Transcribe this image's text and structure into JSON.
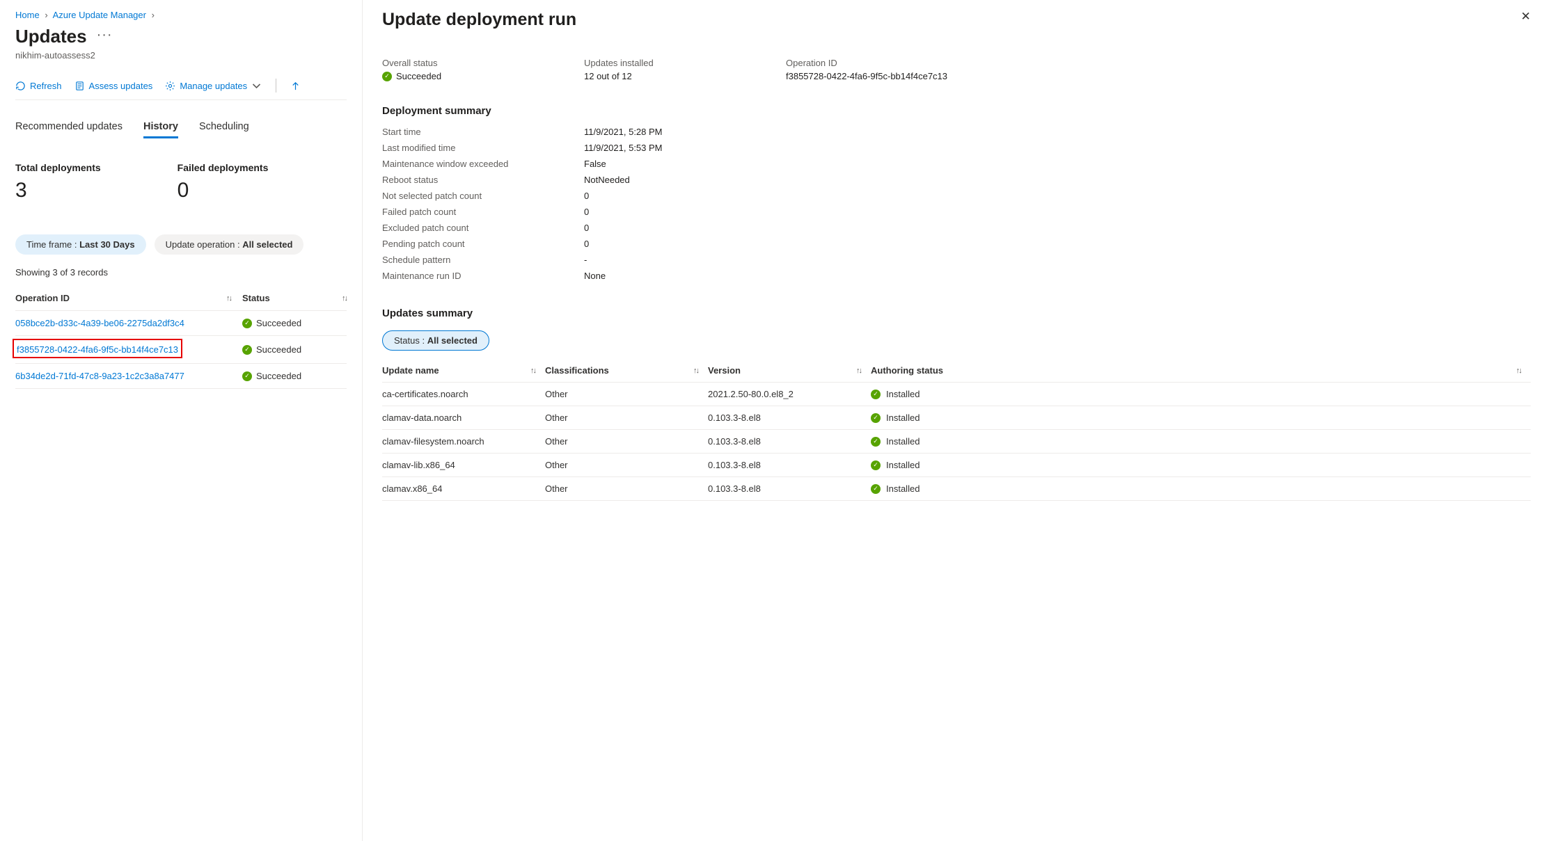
{
  "breadcrumb": {
    "home": "Home",
    "aum": "Azure Update Manager"
  },
  "page": {
    "title": "Updates",
    "subtitle": "nikhim-autoassess2"
  },
  "toolbar": {
    "refresh": "Refresh",
    "assess": "Assess updates",
    "manage": "Manage updates"
  },
  "tabs": {
    "recommended": "Recommended updates",
    "history": "History",
    "scheduling": "Scheduling"
  },
  "stats": {
    "total_label": "Total deployments",
    "total_value": "3",
    "failed_label": "Failed deployments",
    "failed_value": "0"
  },
  "filters": {
    "timeframe_label": "Time frame :",
    "timeframe_value": "Last 30 Days",
    "operation_label": "Update operation :",
    "operation_value": "All selected"
  },
  "records_count": "Showing 3 of 3 records",
  "grid_head": {
    "op": "Operation ID",
    "status": "Status"
  },
  "rows": [
    {
      "id": "058bce2b-d33c-4a39-be06-2275da2df3c4",
      "status": "Succeeded"
    },
    {
      "id": "f3855728-0422-4fa6-9f5c-bb14f4ce7c13",
      "status": "Succeeded"
    },
    {
      "id": "6b34de2d-71fd-47c8-9a23-1c2c3a8a7477",
      "status": "Succeeded"
    }
  ],
  "panel": {
    "title": "Update deployment run",
    "overall_status_label": "Overall status",
    "overall_status_value": "Succeeded",
    "updates_installed_label": "Updates installed",
    "updates_installed_value": "12 out of 12",
    "operation_id_label": "Operation ID",
    "operation_id_value": "f3855728-0422-4fa6-9f5c-bb14f4ce7c13",
    "summary_title": "Deployment summary",
    "kv": [
      {
        "k": "Start time",
        "v": "11/9/2021, 5:28 PM"
      },
      {
        "k": "Last modified time",
        "v": "11/9/2021, 5:53 PM"
      },
      {
        "k": "Maintenance window exceeded",
        "v": "False"
      },
      {
        "k": "Reboot status",
        "v": "NotNeeded"
      },
      {
        "k": "Not selected patch count",
        "v": "0"
      },
      {
        "k": "Failed patch count",
        "v": "0"
      },
      {
        "k": "Excluded patch count",
        "v": "0"
      },
      {
        "k": "Pending patch count",
        "v": "0"
      },
      {
        "k": "Schedule pattern",
        "v": "-"
      },
      {
        "k": "Maintenance run ID",
        "v": "None"
      }
    ],
    "updates_title": "Updates summary",
    "status_filter_label": "Status :",
    "status_filter_value": "All selected",
    "ug_head": {
      "name": "Update name",
      "class": "Classifications",
      "ver": "Version",
      "auth": "Authoring status"
    },
    "updates": [
      {
        "name": "ca-certificates.noarch",
        "class": "Other",
        "ver": "2021.2.50-80.0.el8_2",
        "auth": "Installed"
      },
      {
        "name": "clamav-data.noarch",
        "class": "Other",
        "ver": "0.103.3-8.el8",
        "auth": "Installed"
      },
      {
        "name": "clamav-filesystem.noarch",
        "class": "Other",
        "ver": "0.103.3-8.el8",
        "auth": "Installed"
      },
      {
        "name": "clamav-lib.x86_64",
        "class": "Other",
        "ver": "0.103.3-8.el8",
        "auth": "Installed"
      },
      {
        "name": "clamav.x86_64",
        "class": "Other",
        "ver": "0.103.3-8.el8",
        "auth": "Installed"
      }
    ]
  }
}
